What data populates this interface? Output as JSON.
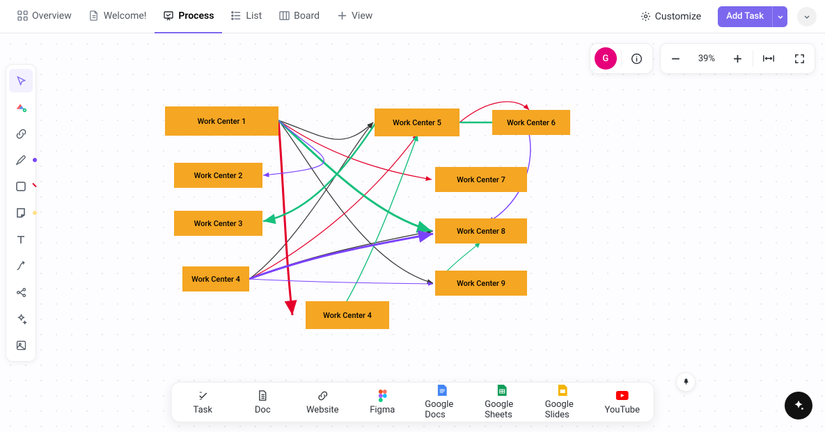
{
  "tabs": {
    "overview": "Overview",
    "welcome": "Welcome!",
    "process": "Process",
    "list": "List",
    "board": "Board",
    "addview": "View"
  },
  "header": {
    "customize": "Customize",
    "addTask": "Add Task"
  },
  "avatar": {
    "initial": "G"
  },
  "zoom": {
    "label": "39%"
  },
  "nodes": {
    "wc1": "Work Center 1",
    "wc2": "Work Center 2",
    "wc3": "Work Center 3",
    "wc4a": "Work Center 4",
    "wc4b": "Work Center 4",
    "wc5": "Work Center 5",
    "wc6": "Work Center 6",
    "wc7": "Work Center 7",
    "wc8": "Work Center 8",
    "wc9": "Work Center 9"
  },
  "insert": {
    "task": "Task",
    "doc": "Doc",
    "website": "Website",
    "figma": "Figma",
    "gdocs": "Google Docs",
    "gsheets": "Google Sheets",
    "gslides": "Google Slides",
    "youtube": "YouTube"
  }
}
